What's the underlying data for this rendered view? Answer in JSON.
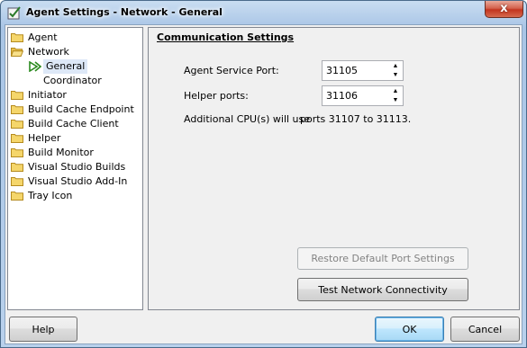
{
  "window": {
    "title": "Agent Settings - Network - General",
    "close_glyph": "x"
  },
  "tree": {
    "items": [
      {
        "label": "Agent",
        "level": 0,
        "icon": "folder-closed-icon"
      },
      {
        "label": "Network",
        "level": 0,
        "icon": "folder-open-icon"
      },
      {
        "label": "General",
        "level": 1,
        "icon": "arrow-right-icon",
        "selected": true
      },
      {
        "label": "Coordinator",
        "level": 1,
        "icon": "none"
      },
      {
        "label": "Initiator",
        "level": 0,
        "icon": "folder-closed-icon"
      },
      {
        "label": "Build Cache Endpoint",
        "level": 0,
        "icon": "folder-closed-icon"
      },
      {
        "label": "Build Cache Client",
        "level": 0,
        "icon": "folder-closed-icon"
      },
      {
        "label": "Helper",
        "level": 0,
        "icon": "folder-closed-icon"
      },
      {
        "label": "Build Monitor",
        "level": 0,
        "icon": "folder-closed-icon"
      },
      {
        "label": "Visual Studio Builds",
        "level": 0,
        "icon": "folder-closed-icon"
      },
      {
        "label": "Visual Studio Add-In",
        "level": 0,
        "icon": "folder-closed-icon"
      },
      {
        "label": "Tray Icon",
        "level": 0,
        "icon": "folder-closed-icon"
      }
    ]
  },
  "panel": {
    "section_title": "Communication Settings",
    "agent_service_port": {
      "label": "Agent Service Port:",
      "value": "31105"
    },
    "helper_ports": {
      "label": "Helper ports:",
      "value": "31106"
    },
    "cpu_text": "Additional CPU(s) will use",
    "cpu_ports": "ports 31107 to 31113.",
    "restore_button": "Restore Default Port Settings",
    "test_button": "Test Network Connectivity"
  },
  "footer": {
    "help_button": "Help",
    "ok_button": "OK",
    "cancel_button": "Cancel"
  },
  "colors": {
    "titlebar": "#b9d1ec",
    "selected_tree_bg": "#dde8f7",
    "default_button_border": "#3c7fb1",
    "close_button": "#c2341e"
  }
}
